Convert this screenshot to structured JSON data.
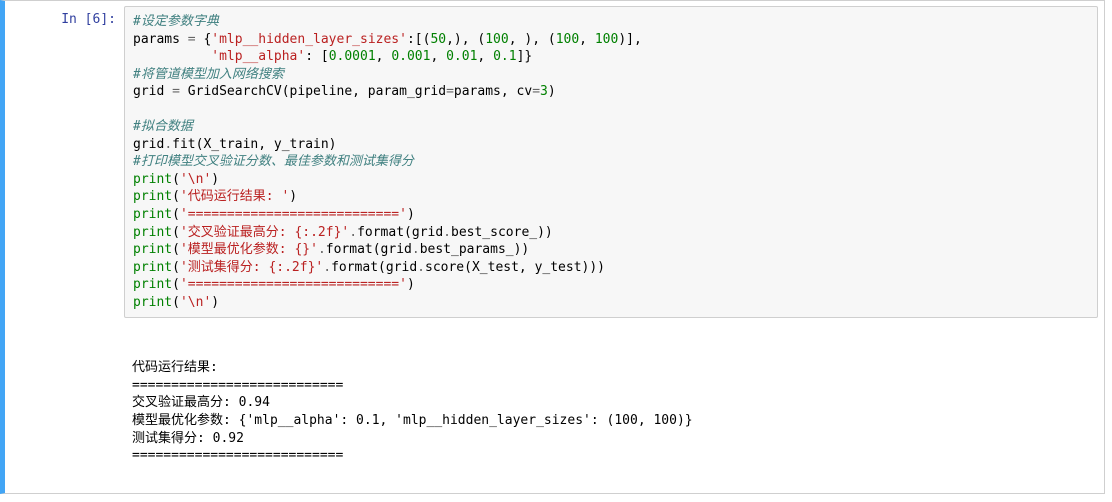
{
  "prompt": "In [6]:",
  "code": {
    "c1": "#设定参数字典",
    "l2a": "params ",
    "l2b": "=",
    "l2c": " {",
    "l2d": "'mlp__hidden_layer_sizes'",
    "l2e": ":[(",
    "l2f": "50",
    "l2g": ",), (",
    "l2h": "100",
    "l2i": ", ), (",
    "l2j": "100",
    "l2k": ", ",
    "l2l": "100",
    "l2m": ")],",
    "l3a": "          ",
    "l3b": "'mlp__alpha'",
    "l3c": ": [",
    "l3d": "0.0001",
    "l3e": ", ",
    "l3f": "0.001",
    "l3g": ", ",
    "l3h": "0.01",
    "l3i": ", ",
    "l3j": "0.1",
    "l3k": "]}",
    "c2": "#将管道模型加入网络搜索",
    "l5a": "grid ",
    "l5b": "=",
    "l5c": " GridSearchCV(pipeline, param_grid",
    "l5d": "=",
    "l5e": "params, cv",
    "l5f": "=",
    "l5g": "3",
    "l5h": ")",
    "c3": "#拟合数据",
    "l8a": "grid",
    "l8b": ".",
    "l8c": "fit(X_train, y_train)",
    "c4": "#打印模型交叉验证分数、最佳参数和测试集得分",
    "p1a": "print",
    "p1b": "(",
    "p1c": "'\\n'",
    "p1d": ")",
    "p2a": "print",
    "p2b": "(",
    "p2c": "'代码运行结果: '",
    "p2d": ")",
    "p3a": "print",
    "p3b": "(",
    "p3c": "'==========================='",
    "p3d": ")",
    "p4a": "print",
    "p4b": "(",
    "p4c": "'交叉验证最高分: {:.2f}'",
    "p4d": ".",
    "p4e": "format(grid",
    "p4f": ".",
    "p4g": "best_score_))",
    "p5a": "print",
    "p5b": "(",
    "p5c": "'模型最优化参数: {}'",
    "p5d": ".",
    "p5e": "format(grid",
    "p5f": ".",
    "p5g": "best_params_))",
    "p6a": "print",
    "p6b": "(",
    "p6c": "'测试集得分: {:.2f}'",
    "p6d": ".",
    "p6e": "format(grid",
    "p6f": ".",
    "p6g": "score(X_test, y_test)))",
    "p7a": "print",
    "p7b": "(",
    "p7c": "'==========================='",
    "p7d": ")",
    "p8a": "print",
    "p8b": "(",
    "p8c": "'\\n'",
    "p8d": ")"
  },
  "output": {
    "blank1": "",
    "line1": "代码运行结果: ",
    "line2": "===========================",
    "line3": "交叉验证最高分: 0.94",
    "line4": "模型最优化参数: {'mlp__alpha': 0.1, 'mlp__hidden_layer_sizes': (100, 100)}",
    "line5": "测试集得分: 0.92",
    "line6": "===========================",
    "blank2": ""
  }
}
